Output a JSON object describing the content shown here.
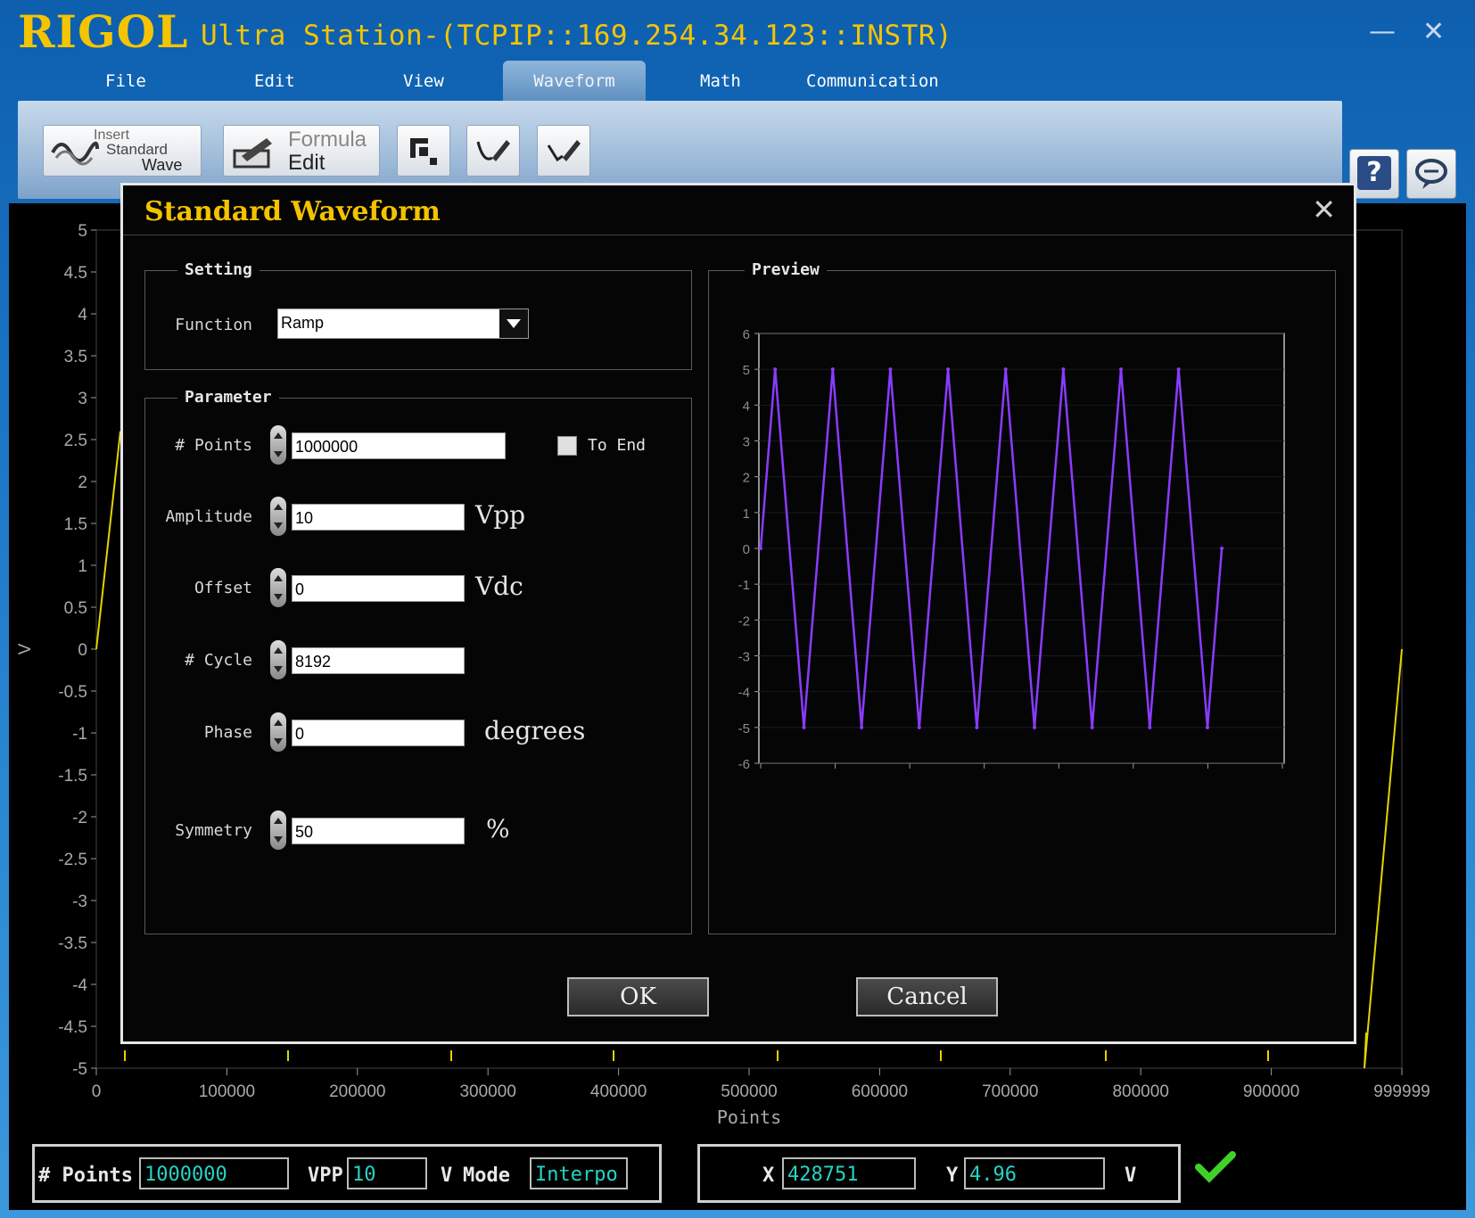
{
  "app": {
    "logo": "RIGOL",
    "title": "Ultra Station-(TCPIP::169.254.34.123::INSTR)",
    "minimize": "—",
    "close": "✕"
  },
  "menu": [
    "File",
    "Edit",
    "View",
    "Waveform",
    "Math",
    "Communication"
  ],
  "menu_active": "Waveform",
  "toolbar": {
    "insert_line1": "Insert",
    "insert_line2": "Standard",
    "insert_line3": "Wave",
    "formula_line1": "Formula",
    "formula_line2": "Edit",
    "help": "?"
  },
  "plot": {
    "y_ticks": [
      "5",
      "4.5",
      "4",
      "3.5",
      "3",
      "2.5",
      "2",
      "1.5",
      "1",
      "0.5",
      "0",
      "-0.5",
      "-1",
      "-1.5",
      "-2",
      "-2.5",
      "-3",
      "-3.5",
      "-4",
      "-4.5",
      "-5"
    ],
    "x_ticks": [
      "0",
      "100000",
      "200000",
      "300000",
      "400000",
      "500000",
      "600000",
      "700000",
      "800000",
      "900000",
      "999999"
    ],
    "ylabel": "V",
    "xlabel": "Points",
    "trace_color": "#e2d400"
  },
  "dialog": {
    "title": "Standard Waveform",
    "close": "✕",
    "setting_title": "Setting",
    "function_label": "Function",
    "function_value": "Ramp",
    "parameter_title": "Parameter",
    "points_label": "# Points",
    "points_value": "1000000",
    "to_end_label": "To End",
    "amplitude_label": "Amplitude",
    "amplitude_value": "10",
    "amplitude_unit": "Vpp",
    "offset_label": "Offset",
    "offset_value": "0",
    "offset_unit": "Vdc",
    "cycle_label": "# Cycle",
    "cycle_value": "8192",
    "phase_label": "Phase",
    "phase_value": "0",
    "phase_unit": "degrees",
    "symmetry_label": "Symmetry",
    "symmetry_value": "50",
    "symmetry_unit": "%",
    "preview_title": "Preview",
    "ok": "OK",
    "cancel": "Cancel"
  },
  "chart_data": {
    "type": "line",
    "title": "",
    "xlabel": "",
    "ylabel": "",
    "ylim": [
      -6,
      6
    ],
    "y_ticks": [
      "6",
      "5",
      "4",
      "3",
      "2",
      "1",
      "0",
      "-1",
      "-2",
      "-3",
      "-4",
      "-5",
      "-6"
    ],
    "series": [
      {
        "color": "#8a3bff",
        "x": [
          0,
          0.25,
          0.75,
          1.25,
          1.75,
          2.25,
          2.75,
          3.25,
          3.75,
          4.25,
          4.75,
          5.25,
          5.75,
          6.25,
          6.75,
          7.25,
          7.75,
          8.0
        ],
        "values": [
          0,
          5,
          -5,
          5,
          -5,
          5,
          -5,
          5,
          -5,
          5,
          -5,
          5,
          -5,
          5,
          -5,
          5,
          -5,
          0
        ]
      }
    ]
  },
  "status": {
    "points_label": "# Points",
    "points_value": "1000000",
    "vpp_label": "VPP",
    "vpp_value": "10",
    "vpp_unit": "V",
    "mode_label": "Mode",
    "mode_value": "Interpo",
    "x_label": "X",
    "x_value": "428751",
    "y_label": "Y",
    "y_value": "4.96",
    "y_unit": "V",
    "ok_color": "#3fd12a"
  }
}
